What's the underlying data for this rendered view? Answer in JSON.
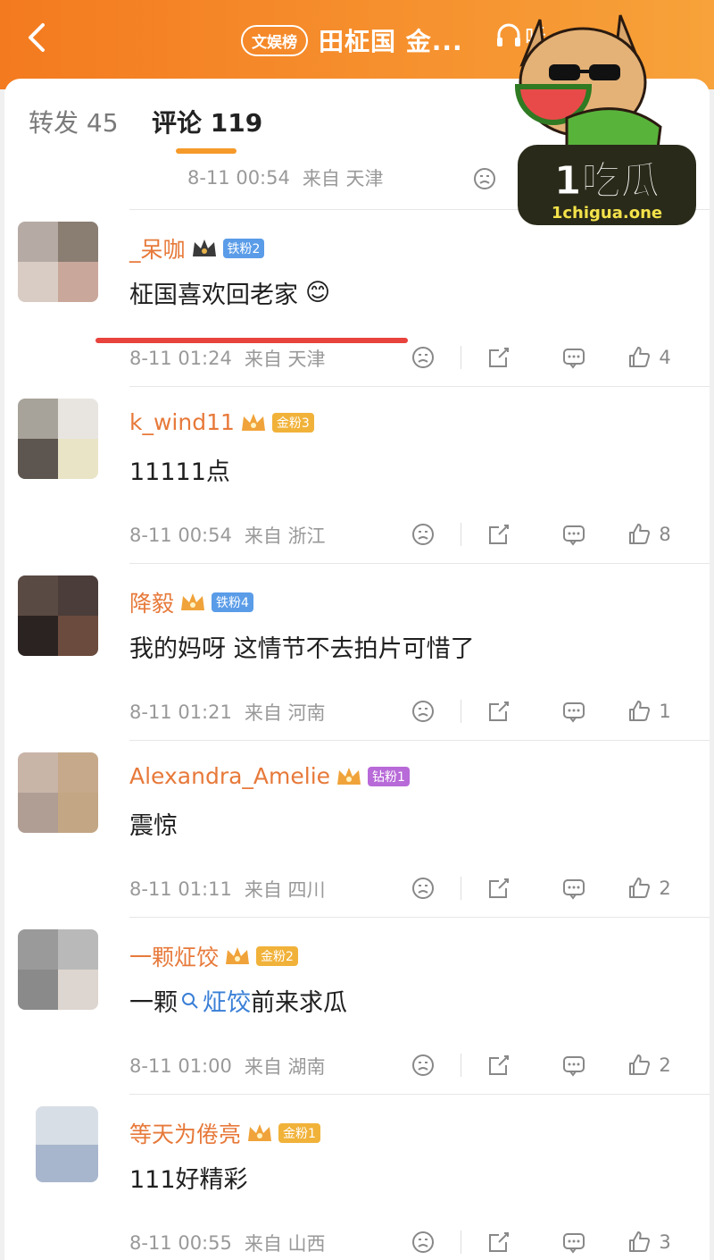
{
  "header": {
    "rank_badge": "文娱榜",
    "title": "田柾国 金...",
    "listen_label": "听",
    "more_label": "•••"
  },
  "tabs": {
    "forward": "转发 45",
    "comments": "评论 119"
  },
  "top_partial": {
    "time": "8-11 00:54",
    "location": "来自 天津"
  },
  "comments": [
    {
      "username": "_呆咖",
      "badge": "铁粉2",
      "text": "柾国喜欢回老家",
      "emoji": "😊",
      "time": "8-11 01:24",
      "location": "来自 天津",
      "likes": "4"
    },
    {
      "username": "k_wind11",
      "badge": "金粉3",
      "text": "11111点",
      "time": "8-11 00:54",
      "location": "来自 浙江",
      "likes": "8"
    },
    {
      "username": "降毅",
      "badge": "铁粉4",
      "text": "我的妈呀 这情节不去拍片可惜了",
      "time": "8-11 01:21",
      "location": "来自 河南",
      "likes": "1"
    },
    {
      "username": "Alexandra_Amelie",
      "badge": "钻粉1",
      "text": "震惊",
      "time": "8-11 01:11",
      "location": "来自 四川",
      "likes": "2"
    },
    {
      "username": "一颗炡饺",
      "badge": "金粉2",
      "text_prefix": "一颗",
      "search_link": "炡饺",
      "text_suffix": "前来求瓜",
      "time": "8-11 01:00",
      "location": "来自 湖南",
      "likes": "2"
    },
    {
      "username": "等天为倦亮",
      "badge": "金粉1",
      "text": "111好精彩",
      "time": "8-11 00:55",
      "location": "来自 山西",
      "likes": "3"
    }
  ],
  "watermark": {
    "brand": "1吃瓜",
    "url": "1chigua.one"
  },
  "colors": {
    "accent": "#f47a1f",
    "username": "#e7793a",
    "iron_badge": "#5a9ce8",
    "gold_badge": "#f1b23a",
    "diamond_badge": "#b86ad8",
    "search_link": "#3a7fd6"
  },
  "icons": [
    "back-icon",
    "headphones-icon",
    "dislike-icon",
    "share-icon",
    "comment-icon",
    "like-icon",
    "crown-icon",
    "search-icon"
  ]
}
